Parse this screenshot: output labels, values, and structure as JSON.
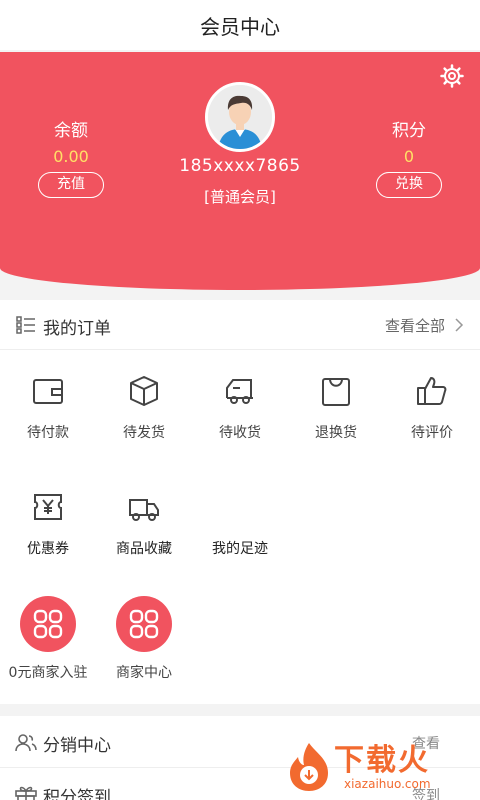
{
  "header": {
    "title": "会员中心"
  },
  "profile": {
    "balance_label": "余额",
    "balance_value": "0.00",
    "recharge": "充值",
    "points_label": "积分",
    "points_value": "0",
    "exchange": "兑换",
    "phone": "185xxxx7865",
    "member_level": "[普通会员]"
  },
  "orders": {
    "title": "我的订单",
    "view_all": "查看全部",
    "items": [
      {
        "label": "待付款",
        "icon": "wallet-icon"
      },
      {
        "label": "待发货",
        "icon": "box-icon"
      },
      {
        "label": "待收货",
        "icon": "truck-icon"
      },
      {
        "label": "退换货",
        "icon": "shopping-bag-icon"
      },
      {
        "label": "待评价",
        "icon": "thumbs-up-icon"
      }
    ]
  },
  "shortcuts": [
    {
      "label": "优惠券",
      "icon": "coupon-icon"
    },
    {
      "label": "商品收藏",
      "icon": "delivery-truck-icon"
    },
    {
      "label": "我的足迹",
      "icon": ""
    }
  ],
  "merchant": [
    {
      "label": "0元商家入驻",
      "icon": "grid-icon"
    },
    {
      "label": "商家中心",
      "icon": "grid-icon"
    }
  ],
  "menu": [
    {
      "label": "分销中心",
      "more": "查看",
      "icon": "users-icon"
    },
    {
      "label": "积分签到",
      "more": "签到",
      "icon": "gift-icon"
    }
  ],
  "watermark": {
    "cn": "下载火",
    "en": "xiazaihuo.com"
  },
  "colors": {
    "accent": "#f1535f",
    "points": "#ffe066",
    "watermark": "#f26a2f"
  }
}
